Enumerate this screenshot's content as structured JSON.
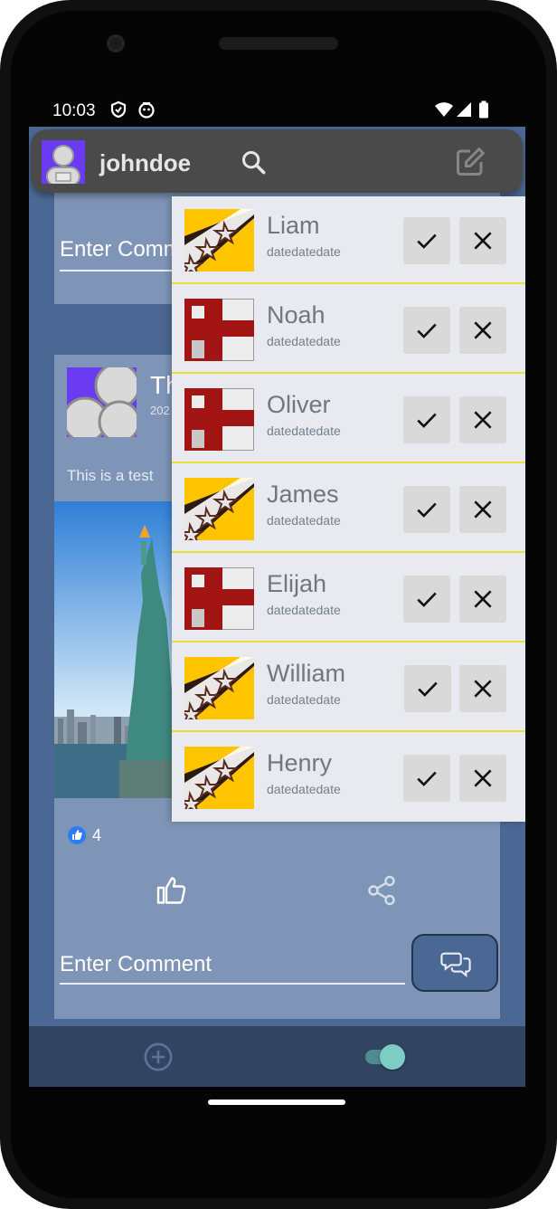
{
  "statusbar": {
    "time": "10:03"
  },
  "appbar": {
    "username": "johndoe"
  },
  "feed": {
    "top_comment_placeholder": "Enter Comm",
    "post": {
      "title_partial": "Th",
      "date_partial": "202",
      "body_partial": "This is a test",
      "likes": "4"
    },
    "comment_placeholder": "Enter Comment"
  },
  "friend_requests": [
    {
      "name": "Liam",
      "date": "datedatedate",
      "flag": "yellow"
    },
    {
      "name": "Noah",
      "date": "datedatedate",
      "flag": "red"
    },
    {
      "name": "Oliver",
      "date": "datedatedate",
      "flag": "red"
    },
    {
      "name": "James",
      "date": "datedatedate",
      "flag": "yellow"
    },
    {
      "name": "Elijah",
      "date": "datedatedate",
      "flag": "red"
    },
    {
      "name": "William",
      "date": "datedatedate",
      "flag": "yellow"
    },
    {
      "name": "Henry",
      "date": "datedatedate",
      "flag": "yellow"
    }
  ],
  "colors": {
    "screen_bg": "#4b6894",
    "card_bg": "#7f95b7",
    "appbar_bg": "#4a4a4a",
    "separator": "#e7df37",
    "toggle_accent": "#7ecdc4"
  }
}
